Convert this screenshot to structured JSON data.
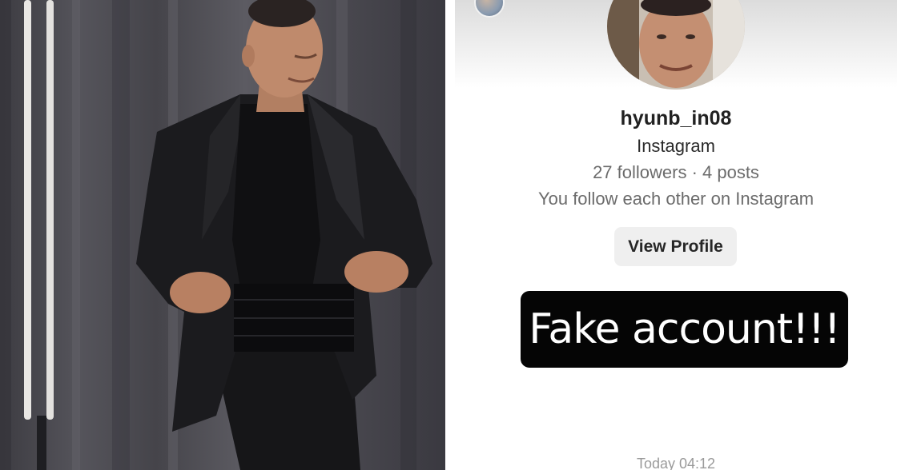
{
  "profile_card": {
    "username": "hyunb_in08",
    "platform": "Instagram",
    "stats": "27 followers · 4 posts",
    "follow_note": "You follow each other on Instagram",
    "view_profile_label": "View Profile"
  },
  "overlay_label": "Fake account!!!",
  "message_timestamp": "Today 04:12",
  "icons": {
    "sender_avatar": "avatar",
    "profile_avatar": "avatar"
  },
  "colors": {
    "label_background": "#050505",
    "label_text": "#ffffff",
    "button_background": "#efefef",
    "muted_text": "#6b6b6b"
  }
}
